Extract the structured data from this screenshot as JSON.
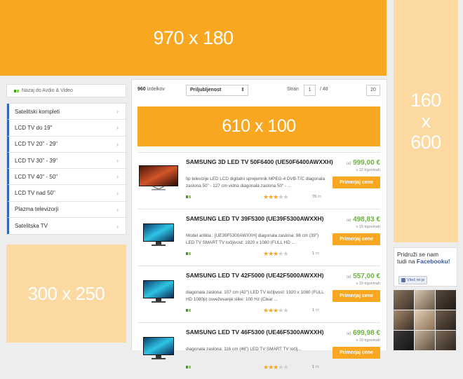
{
  "ads": {
    "top": "970 x 180",
    "skyscraper": [
      "160",
      "x",
      "600"
    ],
    "middle": "610 x 100",
    "rectangle": "300 x 250"
  },
  "back_link": "Nazaj do Avdio & Video",
  "categories": [
    "Satelitski kompleti",
    "LCD TV do 19\"",
    "LCD TV 20\" - 29\"",
    "LCD TV 30\" - 39\"",
    "LCD TV 40\" - 50\"",
    "LCD TV nad 50\"",
    "Plazma televizorji",
    "Satelitska TV"
  ],
  "toolbar": {
    "count": "960",
    "count_label": "izdelkov",
    "sort_value": "Priljubljenost",
    "page_label": "Stran",
    "page_current": "1",
    "page_total": "/ 48",
    "per_page": "20"
  },
  "products": [
    {
      "name": "SAMSUNG 3D LED TV 50F6400 (UE50F6400AWXXH)",
      "desc": "tip televizije LED LCD digitalni sprejemnik MPEG-4 DVB-T/C diagonala zaslona 50\" - 127 cm vidna diagonala zaslona 50\" - ...",
      "rating": 3,
      "reviews": "70",
      "price_prefix": "od",
      "price": "999,00 €",
      "stores": "v 12 trgovinah",
      "button": "Primerjaj cene"
    },
    {
      "name": "SAMSUNG LED TV 39F5300 (UE39F5300AWXXH)",
      "desc": "Model artikla : [UE39F5300AWXXH] diagonala zaslona: 98 cm (39\") LED TV SMART TV ločljivost: 1920 x 1080 (FULL HD ...",
      "rating": 3,
      "reviews": "1",
      "price_prefix": "od",
      "price": "498,83 €",
      "stores": "v 15 trgovinah",
      "button": "Primerjaj cene"
    },
    {
      "name": "SAMSUNG LED TV 42F5000 (UE42F5000AWXXH)",
      "desc": "diagonala zaslona: 107 cm (42\") LED TV ločljivost: 1920 x 1080 (FULL HD 1080p) osveževanje slike: 100 Hz (Clear ...",
      "rating": 3,
      "reviews": "1",
      "price_prefix": "od",
      "price": "557,00 €",
      "stores": "v 19 trgovinah",
      "button": "Primerjaj cene"
    },
    {
      "name": "SAMSUNG LED TV 46F5300 (UE46F5300AWXXH)",
      "desc": "diagonala zaslona: 116 cm (46\") LED TV SMART TV ločlj...",
      "rating": 3,
      "reviews": "1",
      "price_prefix": "od",
      "price": "699,98 €",
      "stores": "v 19 trgovinah",
      "button": "Primerjaj cene"
    }
  ],
  "facebook": {
    "title_line1": "Pridruži se nam",
    "title_line2_prefix": "tudi na",
    "title_brand": "Facebooku!",
    "like": "Všeč mi je"
  },
  "colors": {
    "accent": "#f9a620",
    "price": "#6cb33e",
    "category_border": "#2b6bb3",
    "facebook": "#3b5998"
  }
}
